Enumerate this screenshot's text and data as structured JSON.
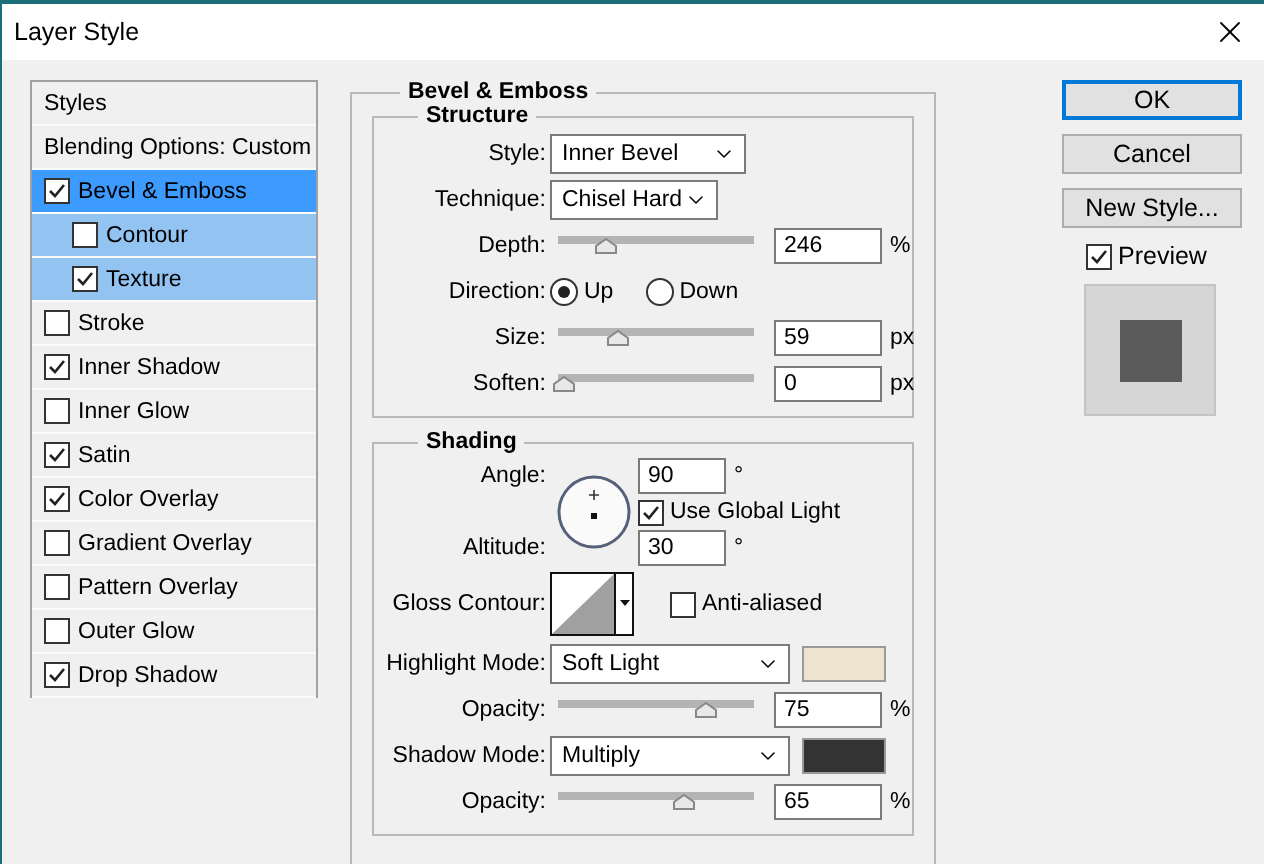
{
  "window": {
    "title": "Layer Style"
  },
  "sidebar": {
    "items": [
      {
        "kind": "header",
        "label": "Styles",
        "selected": false
      },
      {
        "kind": "header",
        "label": "Blending Options: Custom",
        "selected": false
      },
      {
        "kind": "effect",
        "label": "Bevel & Emboss",
        "checked": true,
        "selected": true,
        "children": [
          {
            "kind": "effect",
            "label": "Contour",
            "checked": false,
            "selected": false
          },
          {
            "kind": "effect",
            "label": "Texture",
            "checked": true,
            "selected": false
          }
        ]
      },
      {
        "kind": "effect",
        "label": "Stroke",
        "checked": false,
        "selected": false
      },
      {
        "kind": "effect",
        "label": "Inner Shadow",
        "checked": true,
        "selected": false
      },
      {
        "kind": "effect",
        "label": "Inner Glow",
        "checked": false,
        "selected": false
      },
      {
        "kind": "effect",
        "label": "Satin",
        "checked": true,
        "selected": false
      },
      {
        "kind": "effect",
        "label": "Color Overlay",
        "checked": true,
        "selected": false
      },
      {
        "kind": "effect",
        "label": "Gradient Overlay",
        "checked": false,
        "selected": false
      },
      {
        "kind": "effect",
        "label": "Pattern Overlay",
        "checked": false,
        "selected": false
      },
      {
        "kind": "effect",
        "label": "Outer Glow",
        "checked": false,
        "selected": false
      },
      {
        "kind": "effect",
        "label": "Drop Shadow",
        "checked": true,
        "selected": false
      }
    ]
  },
  "panel": {
    "title": "Bevel & Emboss",
    "structure": {
      "title": "Structure",
      "rows": [
        {
          "kind": "select",
          "label": "Style:",
          "value": "Inner Bevel"
        },
        {
          "kind": "select",
          "label": "Technique:",
          "value": "Chisel Hard"
        },
        {
          "kind": "slider",
          "label": "Depth:",
          "level": 0.23,
          "value": "246",
          "unit": "%"
        },
        {
          "kind": "radio",
          "label": "Direction:",
          "options": [
            {
              "label": "Up",
              "selected": true
            },
            {
              "label": "Down",
              "selected": false
            }
          ]
        },
        {
          "kind": "slider",
          "label": "Size:",
          "level": 0.29,
          "value": "59",
          "unit": "px"
        },
        {
          "kind": "slider",
          "label": "Soften:",
          "level": 0,
          "value": "0",
          "unit": "px"
        }
      ]
    },
    "shading": {
      "title": "Shading",
      "rows": [
        {
          "kind": "angle",
          "label": "Angle:",
          "value": "90",
          "unit": "°",
          "global_light": {
            "label": "Use Global Light",
            "checked": true
          },
          "altitude": {
            "label": "Altitude:",
            "value": "30",
            "unit": "°"
          }
        },
        {
          "kind": "contour",
          "label": "Gloss Contour:",
          "anti_aliased": {
            "label": "Anti-aliased",
            "checked": false
          }
        },
        {
          "kind": "select",
          "label": "Highlight Mode:",
          "value": "Soft Light",
          "color": "#ede3cf"
        },
        {
          "kind": "slider",
          "label": "Opacity:",
          "level": 0.77,
          "value": "75",
          "unit": "%"
        },
        {
          "kind": "select",
          "label": "Shadow Mode:",
          "value": "Multiply",
          "color": "#333333"
        },
        {
          "kind": "slider",
          "label": "Opacity:",
          "level": 0.65,
          "value": "65",
          "unit": "%"
        }
      ]
    }
  },
  "buttons": [
    {
      "label": "OK",
      "default": true
    },
    {
      "label": "Cancel",
      "default": false
    },
    {
      "label": "New Style...",
      "default": false
    }
  ],
  "preview": {
    "label": "Preview",
    "checked": true
  }
}
